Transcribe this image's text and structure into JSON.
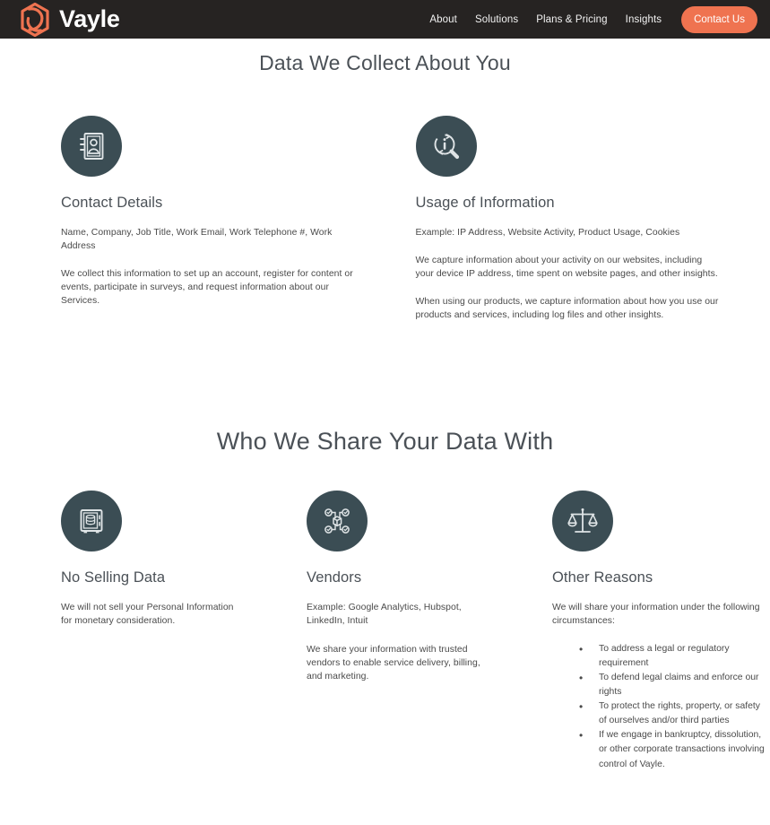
{
  "navbar": {
    "brand": {
      "name": "Vayle",
      "logo_icon": "hexagon-swirl-logo-icon",
      "accent_color": "#ef7350"
    },
    "background_color": "#262322",
    "links": [
      {
        "label": "About",
        "name": "nav-link-about"
      },
      {
        "label": "Solutions",
        "name": "nav-link-solutions"
      },
      {
        "label": "Plans & Pricing",
        "name": "nav-link-plans-pricing"
      },
      {
        "label": "Insights",
        "name": "nav-link-insights"
      }
    ],
    "cta": {
      "label": "Contact Us"
    }
  },
  "sections": [
    {
      "title": "Data We Collect About You",
      "cards": [
        {
          "icon": "contact-book-icon",
          "title": "Contact Details",
          "paragraphs": [
            "Name, Company, Job Title, Work Email, Work Telephone #, Work Address",
            "We collect this information to set up an account, register for content or events, participate in surveys, and request information about our Services."
          ]
        },
        {
          "icon": "info-magnifier-icon",
          "title": "Usage of Information",
          "paragraphs": [
            "Example: IP Address, Website Activity, Product Usage, Cookies",
            "We capture information about your activity on our websites, including your device IP address, time spent on website pages, and other insights.",
            "When using our products, we capture information about how you use our products and services, including log files and other insights."
          ]
        }
      ]
    },
    {
      "title": "Who We Share Your Data With",
      "cards": [
        {
          "icon": "safe-vault-database-icon",
          "title": "No Selling Data",
          "paragraphs": [
            "We will not sell your Personal Information for monetary consideration."
          ]
        },
        {
          "icon": "vendor-network-icon",
          "title": "Vendors",
          "paragraphs": [
            "Example: Google Analytics, Hubspot, LinkedIn, Intuit",
            "We share your information with trusted vendors to enable service delivery, billing, and marketing."
          ]
        },
        {
          "icon": "scales-of-justice-icon",
          "title": "Other Reasons",
          "paragraphs": [
            "We will share your information under the following circumstances:"
          ],
          "bullets": [
            "To address a legal or regulatory requirement",
            "To defend legal claims and enforce our rights",
            "To protect the rights, property, or safety of ourselves and/or third parties",
            "If we engage in bankruptcy, dissolution, or other corporate transactions involving control of Vayle."
          ]
        }
      ]
    }
  ],
  "theme": {
    "icon_circle_color": "#3b4d54",
    "heading_color": "#4b5157",
    "body_text_color": "#4a4a4a"
  }
}
